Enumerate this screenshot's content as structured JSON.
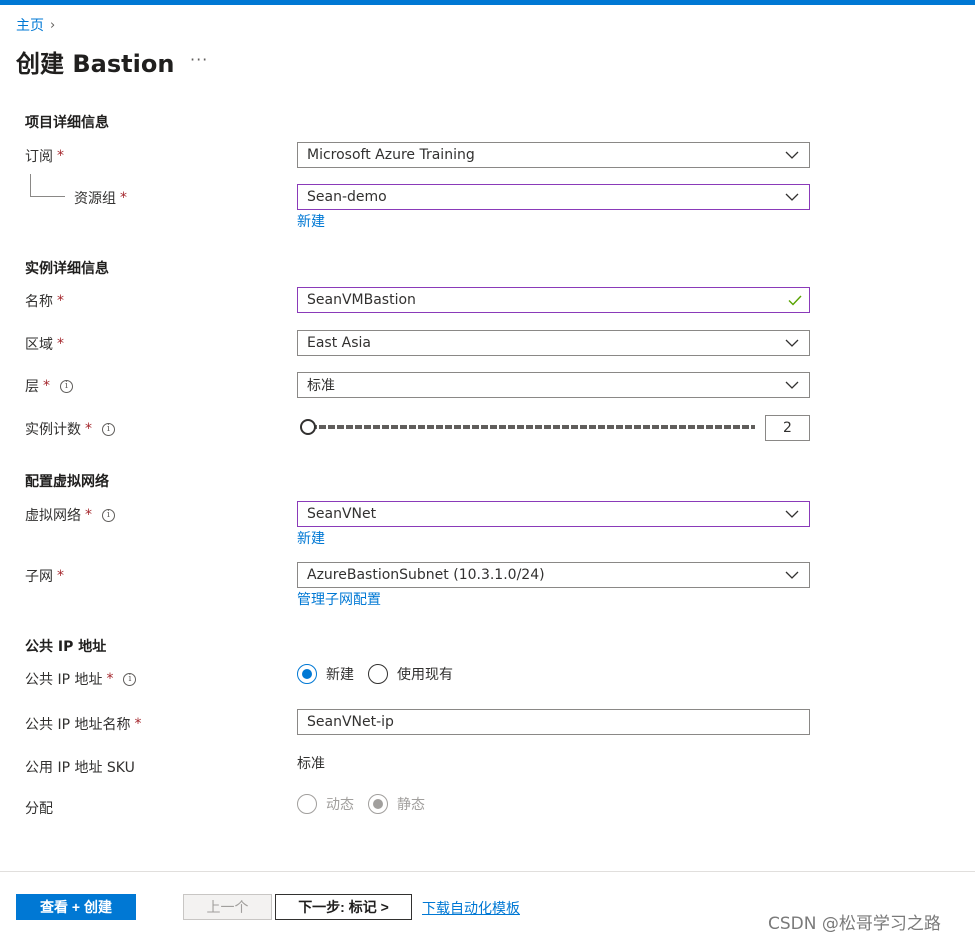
{
  "breadcrumb": {
    "home": "主页",
    "separator": "›"
  },
  "page": {
    "title": "创建 Bastion",
    "more": "···"
  },
  "colors": {
    "accent": "#0078d4",
    "required": "#a4262c",
    "focus_border": "#8a3ab9",
    "valid": "#57a300"
  },
  "project": {
    "section_title": "项目详细信息",
    "subscription": {
      "label": "订阅",
      "required": "*",
      "value": "Microsoft Azure Training"
    },
    "resource_group": {
      "label": "资源组",
      "required": "*",
      "value": "Sean-demo",
      "new_link": "新建"
    }
  },
  "instance": {
    "section_title": "实例详细信息",
    "name": {
      "label": "名称",
      "required": "*",
      "value": "SeanVMBastion",
      "status_icon": "check-icon"
    },
    "region": {
      "label": "区域",
      "required": "*",
      "value": "East Asia"
    },
    "tier": {
      "label": "层",
      "required": "*",
      "value": "标准"
    },
    "instance_count": {
      "label": "实例计数",
      "required": "*",
      "value": "2",
      "slider_position": 0
    }
  },
  "vnet": {
    "section_title": "配置虚拟网络",
    "virtual_network": {
      "label": "虚拟网络",
      "required": "*",
      "value": "SeanVNet",
      "new_link": "新建"
    },
    "subnet": {
      "label": "子网",
      "required": "*",
      "value": "AzureBastionSubnet (10.3.1.0/24)",
      "manage_link": "管理子网配置"
    }
  },
  "public_ip": {
    "section_title": "公共 IP 地址",
    "address": {
      "label": "公共 IP 地址",
      "required": "*",
      "option_new": "新建",
      "option_existing": "使用现有",
      "selected": "新建"
    },
    "name": {
      "label": "公共 IP 地址名称",
      "required": "*",
      "value": "SeanVNet-ip"
    },
    "sku": {
      "label": "公用 IP 地址 SKU",
      "value": "标准"
    },
    "assignment": {
      "label": "分配",
      "option_dynamic": "动态",
      "option_static": "静态",
      "selected": "静态"
    }
  },
  "footer": {
    "review_create": "查看 + 创建",
    "previous": "上一个",
    "next": "下一步: 标记 >",
    "download_template": "下载自动化模板"
  },
  "watermark": "CSDN @松哥学习之路"
}
